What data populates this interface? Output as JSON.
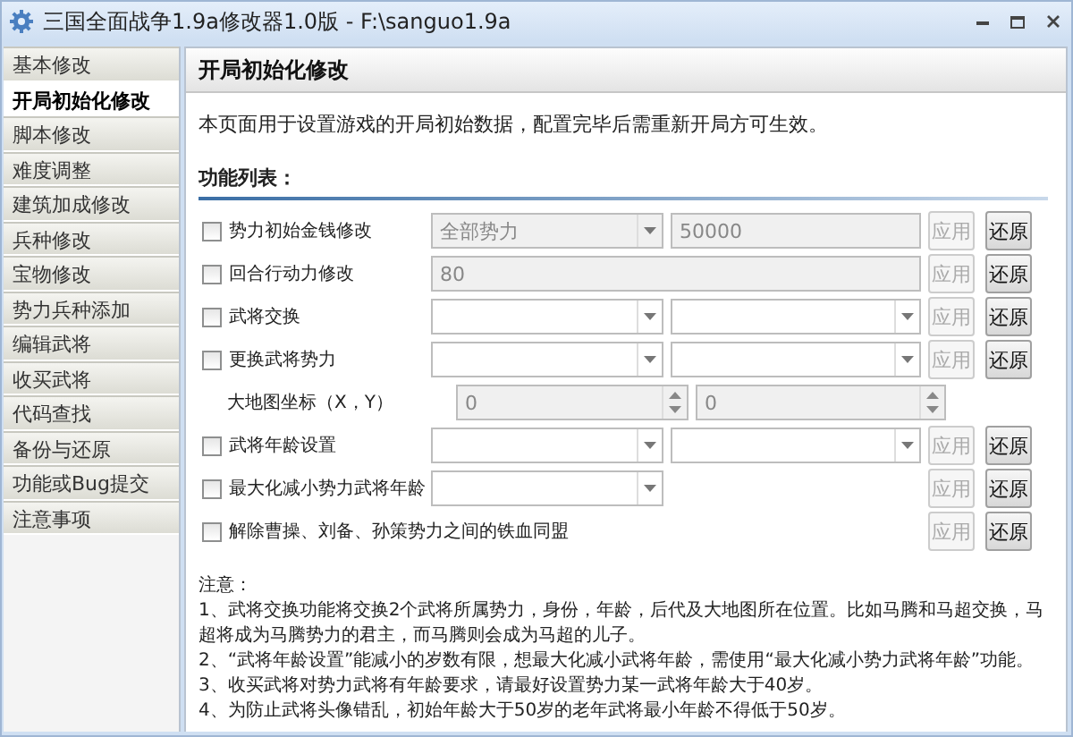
{
  "window": {
    "title": "三国全面战争1.9a修改器1.0版 - F:\\sanguo1.9a"
  },
  "sidebar": {
    "items": [
      {
        "label": "基本修改",
        "selected": false
      },
      {
        "label": "开局初始化修改",
        "selected": true
      },
      {
        "label": "脚本修改",
        "selected": false
      },
      {
        "label": "难度调整",
        "selected": false
      },
      {
        "label": "建筑加成修改",
        "selected": false
      },
      {
        "label": "兵种修改",
        "selected": false
      },
      {
        "label": "宝物修改",
        "selected": false
      },
      {
        "label": "势力兵种添加",
        "selected": false
      },
      {
        "label": "编辑武将",
        "selected": false
      },
      {
        "label": "收买武将",
        "selected": false
      },
      {
        "label": "代码查找",
        "selected": false
      },
      {
        "label": "备份与还原",
        "selected": false
      },
      {
        "label": "功能或Bug提交",
        "selected": false
      },
      {
        "label": "注意事项",
        "selected": false
      }
    ]
  },
  "panel": {
    "title": "开局初始化修改",
    "description": "本页面用于设置游戏的开局初始数据，配置完毕后需重新开局方可生效。",
    "section_title": "功能列表：",
    "rows": [
      {
        "kind": "option",
        "label": "势力初始金钱修改",
        "checked": false,
        "fields": [
          {
            "kind": "combo",
            "value": "全部势力",
            "disabled": true
          },
          {
            "kind": "text",
            "value": "50000",
            "disabled": true
          }
        ],
        "apply": {
          "label": "应用",
          "disabled": true
        },
        "restore": {
          "label": "还原"
        }
      },
      {
        "kind": "option",
        "label": "回合行动力修改",
        "checked": false,
        "fields": [
          {
            "kind": "wide",
            "value": "80",
            "disabled": true
          }
        ],
        "apply": {
          "label": "应用",
          "disabled": true
        },
        "restore": {
          "label": "还原"
        }
      },
      {
        "kind": "option",
        "label": "武将交换",
        "checked": false,
        "fields": [
          {
            "kind": "combo",
            "disabled": false
          },
          {
            "kind": "combo",
            "disabled": false
          }
        ],
        "apply": {
          "label": "应用",
          "disabled": true
        },
        "restore": {
          "label": "还原"
        }
      },
      {
        "kind": "option",
        "label": "更换武将势力",
        "checked": false,
        "fields": [
          {
            "kind": "combo",
            "disabled": false
          },
          {
            "kind": "combo",
            "disabled": false
          }
        ],
        "apply": {
          "label": "应用",
          "disabled": true
        },
        "restore": {
          "label": "还原"
        }
      },
      {
        "kind": "sub",
        "label": "大地图坐标（X，Y）",
        "fields": [
          {
            "kind": "spin",
            "value": "0",
            "disabled": true
          },
          {
            "kind": "spin",
            "value": "0",
            "disabled": true
          }
        ]
      },
      {
        "kind": "option",
        "label": "武将年龄设置",
        "checked": false,
        "fields": [
          {
            "kind": "combo",
            "disabled": false
          },
          {
            "kind": "combo",
            "disabled": false
          }
        ],
        "apply": {
          "label": "应用",
          "disabled": true
        },
        "restore": {
          "label": "还原"
        }
      },
      {
        "kind": "option",
        "label": "最大化减小势力武将年龄",
        "checked": false,
        "fields": [
          {
            "kind": "combo",
            "disabled": false
          }
        ],
        "apply": {
          "label": "应用",
          "disabled": true
        },
        "restore": {
          "label": "还原"
        }
      },
      {
        "kind": "long",
        "label": "解除曹操、刘备、孙策势力之间的铁血同盟",
        "checked": false,
        "apply": {
          "label": "应用",
          "disabled": true
        },
        "restore": {
          "label": "还原"
        }
      }
    ],
    "notes": {
      "title": "注意：",
      "lines": [
        "1、武将交换功能将交换2个武将所属势力，身份，年龄，后代及大地图所在位置。比如马腾和马超交换，马超将成为马腾势力的君主，而马腾则会成为马超的儿子。",
        "2、“武将年龄设置”能减小的岁数有限，想最大化减小武将年龄，需使用“最大化减小势力武将年龄”功能。",
        "3、收买武将对势力武将有年龄要求，请最好设置势力某一武将年龄大于40岁。",
        "4、为防止武将头像错乱，初始年龄大于50岁的老年武将最小年龄不得低于50岁。"
      ]
    }
  }
}
